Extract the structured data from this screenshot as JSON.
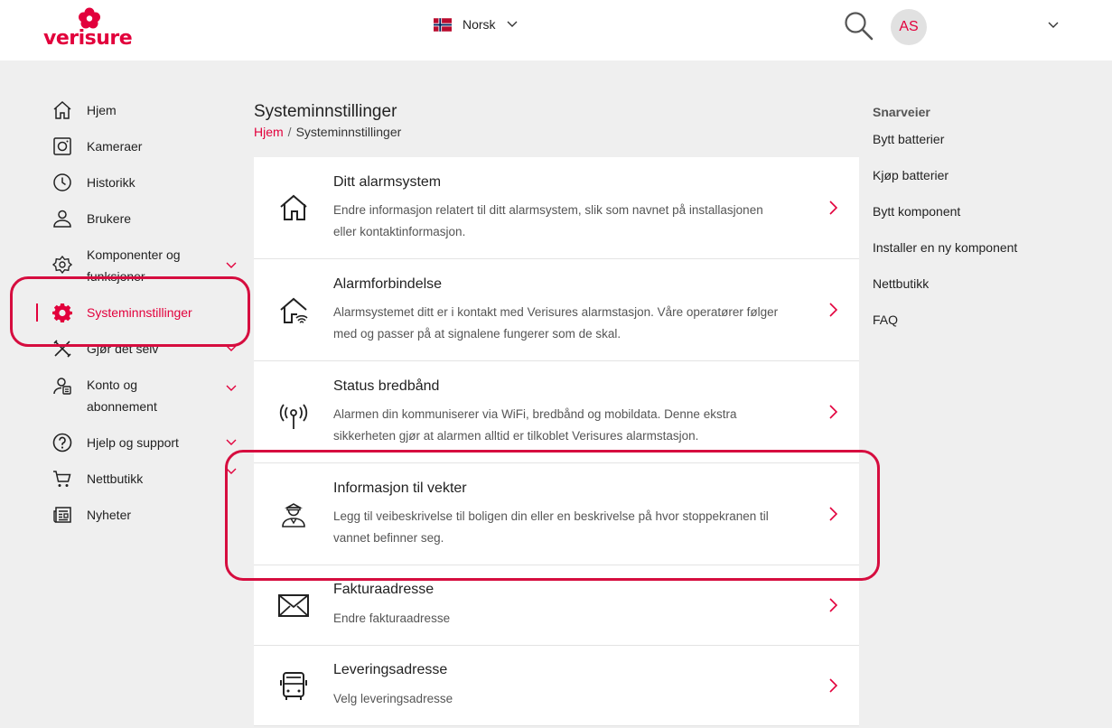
{
  "header": {
    "logo_text": "verisure",
    "language": "Norsk",
    "avatar_initials": "AS"
  },
  "sidebar": {
    "items": [
      {
        "label": "Hjem",
        "icon": "home-icon"
      },
      {
        "label": "Kameraer",
        "icon": "camera-icon"
      },
      {
        "label": "Historikk",
        "icon": "clock-icon"
      },
      {
        "label": "Brukere",
        "icon": "users-icon"
      },
      {
        "label": "Komponenter og funksjoner",
        "icon": "components-icon",
        "expandable": true
      },
      {
        "label": "Systeminnstillinger",
        "icon": "gear-icon",
        "active": true
      },
      {
        "label": "Gjør det selv",
        "icon": "tools-icon",
        "expandable": true
      },
      {
        "label": "Konto og abonnement",
        "icon": "account-icon",
        "expandable": true
      },
      {
        "label": "Hjelp og support",
        "icon": "help-icon",
        "expandable": true
      },
      {
        "label": "Nettbutikk",
        "icon": "cart-icon",
        "expandable": true
      },
      {
        "label": "Nyheter",
        "icon": "news-icon"
      }
    ]
  },
  "main": {
    "title": "Systeminnstillinger",
    "breadcrumb": {
      "home": "Hjem",
      "separator": "/",
      "current": "Systeminnstillinger"
    },
    "cards": [
      {
        "title": "Ditt alarmsystem",
        "icon": "house-icon",
        "desc1": "Endre informasjon relatert til ditt alarmsystem, slik som navnet på installasjonen",
        "desc2": "eller kontaktinformasjon."
      },
      {
        "title": "Alarmforbindelse",
        "icon": "house-wifi-icon",
        "desc1": "Alarmsystemet ditt er i kontakt med Verisures alarmstasjon. Våre operatører følger",
        "desc2": "med og passer på at signalene fungerer som de skal."
      },
      {
        "title": "Status bredbånd",
        "icon": "antenna-icon",
        "desc1": "Alarmen din kommuniserer via WiFi, bredbånd og mobildata. Denne ekstra",
        "desc2": "sikkerheten gjør at alarmen alltid er tilkoblet Verisures alarmstasjon."
      },
      {
        "title": "Informasjon til vekter",
        "icon": "guard-icon",
        "desc1": "Legg til veibeskrivelse til boligen din eller en beskrivelse på hvor stoppekranen til",
        "desc2": "vannet befinner seg."
      },
      {
        "title": "Fakturaadresse",
        "icon": "envelope-icon",
        "desc1": "Endre fakturaadresse",
        "desc2": ""
      },
      {
        "title": "Leveringsadresse",
        "icon": "bus-icon",
        "desc1": "Velg leveringsadresse",
        "desc2": ""
      }
    ]
  },
  "shortcuts": {
    "heading": "Snarveier",
    "items": [
      "Bytt batterier",
      "Kjøp batterier",
      "Bytt komponent",
      "Installer en ny komponent",
      "Nettbutikk",
      "FAQ"
    ]
  },
  "colors": {
    "brand": "#e2003c",
    "annotation": "#d60d3f",
    "background": "#efefef"
  }
}
